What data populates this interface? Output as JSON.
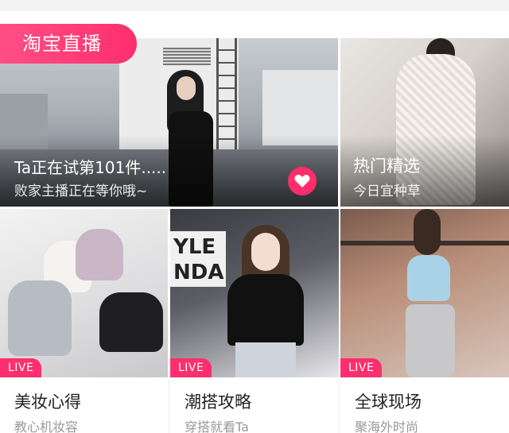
{
  "section": {
    "title": "淘宝直播"
  },
  "hero": {
    "title": "Ta正在试第101件.....",
    "subtitle": "败家主播正在等你哦~",
    "like_icon": "heart-icon",
    "accent": "#ff2d6b"
  },
  "hot": {
    "title": "热门精选",
    "subtitle": "今日宜种草"
  },
  "cards": [
    {
      "badge": "LIVE",
      "title": "美妆心得",
      "subtitle": "教心机妆容"
    },
    {
      "badge": "LIVE",
      "title": "潮搭攻略",
      "subtitle": "穿搭就看Ta"
    },
    {
      "badge": "LIVE",
      "title": "全球现场",
      "subtitle": "聚海外时尚"
    }
  ],
  "p2_sign": "YLE\nNDA",
  "colors": {
    "brand_pink": "#ff2e6e",
    "text_dark": "#222222",
    "text_muted": "#999999"
  }
}
